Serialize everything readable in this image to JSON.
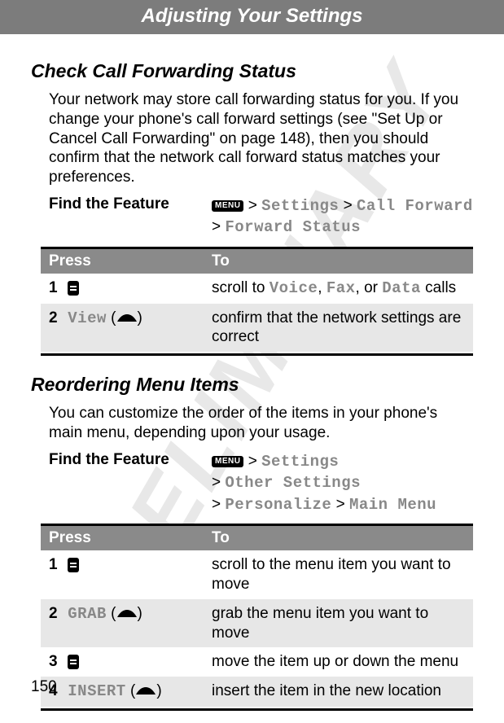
{
  "watermark": "PRELIMINARY",
  "header": "Adjusting Your Settings",
  "page_number": "150",
  "section1": {
    "title": "Check Call Forwarding Status",
    "body": "Your network may store call forwarding status for you. If you change your phone's call forward settings (see \"Set Up or Cancel Call Forwarding\" on page 148), then you should confirm that the network call forward status matches your preferences.",
    "find_label": "Find the Feature",
    "menu_key": "MENU",
    "path": {
      "a": "Settings",
      "b": "Call Forward",
      "c": "Forward Status"
    },
    "table": {
      "head_press": "Press",
      "head_to": "To",
      "rows": [
        {
          "num": "1",
          "to_pre": "scroll to ",
          "to_v": "Voice",
          "to_sep1": ", ",
          "to_f": "Fax",
          "to_sep2": ", or ",
          "to_d": "Data",
          "to_post": " calls"
        },
        {
          "num": "2",
          "btn": "View",
          "to": "confirm that the network settings are correct"
        }
      ]
    }
  },
  "section2": {
    "title": "Reordering Menu Items",
    "body": "You can customize the order of the items in your phone's main menu, depending upon your usage.",
    "find_label": "Find the Feature",
    "menu_key": "MENU",
    "path": {
      "a": "Settings",
      "b": "Other Settings",
      "c": "Personalize",
      "d": "Main Menu"
    },
    "table": {
      "head_press": "Press",
      "head_to": "To",
      "rows": [
        {
          "num": "1",
          "to": "scroll to the menu item you want to move"
        },
        {
          "num": "2",
          "btn": "GRAB",
          "to": "grab the menu item you want to move"
        },
        {
          "num": "3",
          "to": "move the item up or down the menu"
        },
        {
          "num": "4",
          "btn": "INSERT",
          "to": "insert the item in the new location"
        }
      ]
    }
  }
}
